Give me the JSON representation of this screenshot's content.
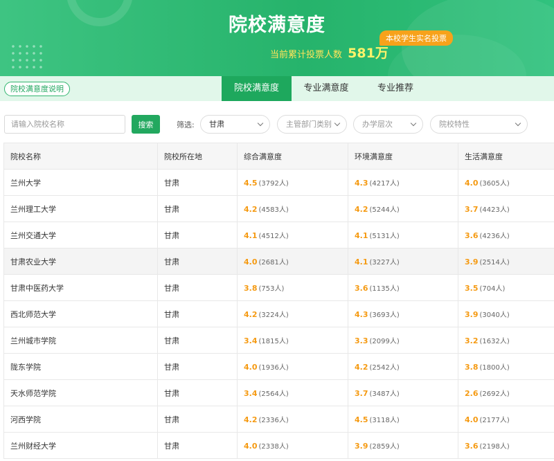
{
  "banner": {
    "title": "院校满意度",
    "vote_text": "当前累计投票人数",
    "vote_count": "581万",
    "badge": "本校学生实名投票"
  },
  "tabbar": {
    "explain": "院校满意度说明",
    "tabs": [
      {
        "label": "院校满意度",
        "active": true
      },
      {
        "label": "专业满意度",
        "active": false
      },
      {
        "label": "专业推荐",
        "active": false
      }
    ]
  },
  "filters": {
    "search_placeholder": "请输入院校名称",
    "search_button": "搜索",
    "label": "筛选:",
    "province": "甘肃",
    "department": "主管部门类别",
    "level": "办学层次",
    "feature": "院校特性"
  },
  "table": {
    "headers": [
      "院校名称",
      "院校所在地",
      "综合满意度",
      "环境满意度",
      "生活满意度"
    ],
    "rows": [
      {
        "name": "兰州大学",
        "loc": "甘肃",
        "overall": "4.5",
        "overall_n": "(3792人)",
        "env": "4.3",
        "env_n": "(4217人)",
        "life": "4.0",
        "life_n": "(3605人)"
      },
      {
        "name": "兰州理工大学",
        "loc": "甘肃",
        "overall": "4.2",
        "overall_n": "(4583人)",
        "env": "4.2",
        "env_n": "(5244人)",
        "life": "3.7",
        "life_n": "(4423人)"
      },
      {
        "name": "兰州交通大学",
        "loc": "甘肃",
        "overall": "4.1",
        "overall_n": "(4512人)",
        "env": "4.1",
        "env_n": "(5131人)",
        "life": "3.6",
        "life_n": "(4236人)"
      },
      {
        "name": "甘肃农业大学",
        "loc": "甘肃",
        "overall": "4.0",
        "overall_n": "(2681人)",
        "env": "4.1",
        "env_n": "(3227人)",
        "life": "3.9",
        "life_n": "(2514人)"
      },
      {
        "name": "甘肃中医药大学",
        "loc": "甘肃",
        "overall": "3.8",
        "overall_n": "(753人)",
        "env": "3.6",
        "env_n": "(1135人)",
        "life": "3.5",
        "life_n": "(704人)"
      },
      {
        "name": "西北师范大学",
        "loc": "甘肃",
        "overall": "4.2",
        "overall_n": "(3224人)",
        "env": "4.3",
        "env_n": "(3693人)",
        "life": "3.9",
        "life_n": "(3040人)"
      },
      {
        "name": "兰州城市学院",
        "loc": "甘肃",
        "overall": "3.4",
        "overall_n": "(1815人)",
        "env": "3.3",
        "env_n": "(2099人)",
        "life": "3.2",
        "life_n": "(1632人)"
      },
      {
        "name": "陇东学院",
        "loc": "甘肃",
        "overall": "4.0",
        "overall_n": "(1936人)",
        "env": "4.2",
        "env_n": "(2542人)",
        "life": "3.8",
        "life_n": "(1800人)"
      },
      {
        "name": "天水师范学院",
        "loc": "甘肃",
        "overall": "3.4",
        "overall_n": "(2564人)",
        "env": "3.7",
        "env_n": "(3487人)",
        "life": "2.6",
        "life_n": "(2692人)"
      },
      {
        "name": "河西学院",
        "loc": "甘肃",
        "overall": "4.2",
        "overall_n": "(2336人)",
        "env": "4.5",
        "env_n": "(3118人)",
        "life": "4.0",
        "life_n": "(2177人)"
      },
      {
        "name": "兰州财经大学",
        "loc": "甘肃",
        "overall": "4.0",
        "overall_n": "(2338人)",
        "env": "3.9",
        "env_n": "(2859人)",
        "life": "3.6",
        "life_n": "(2198人)"
      }
    ]
  }
}
